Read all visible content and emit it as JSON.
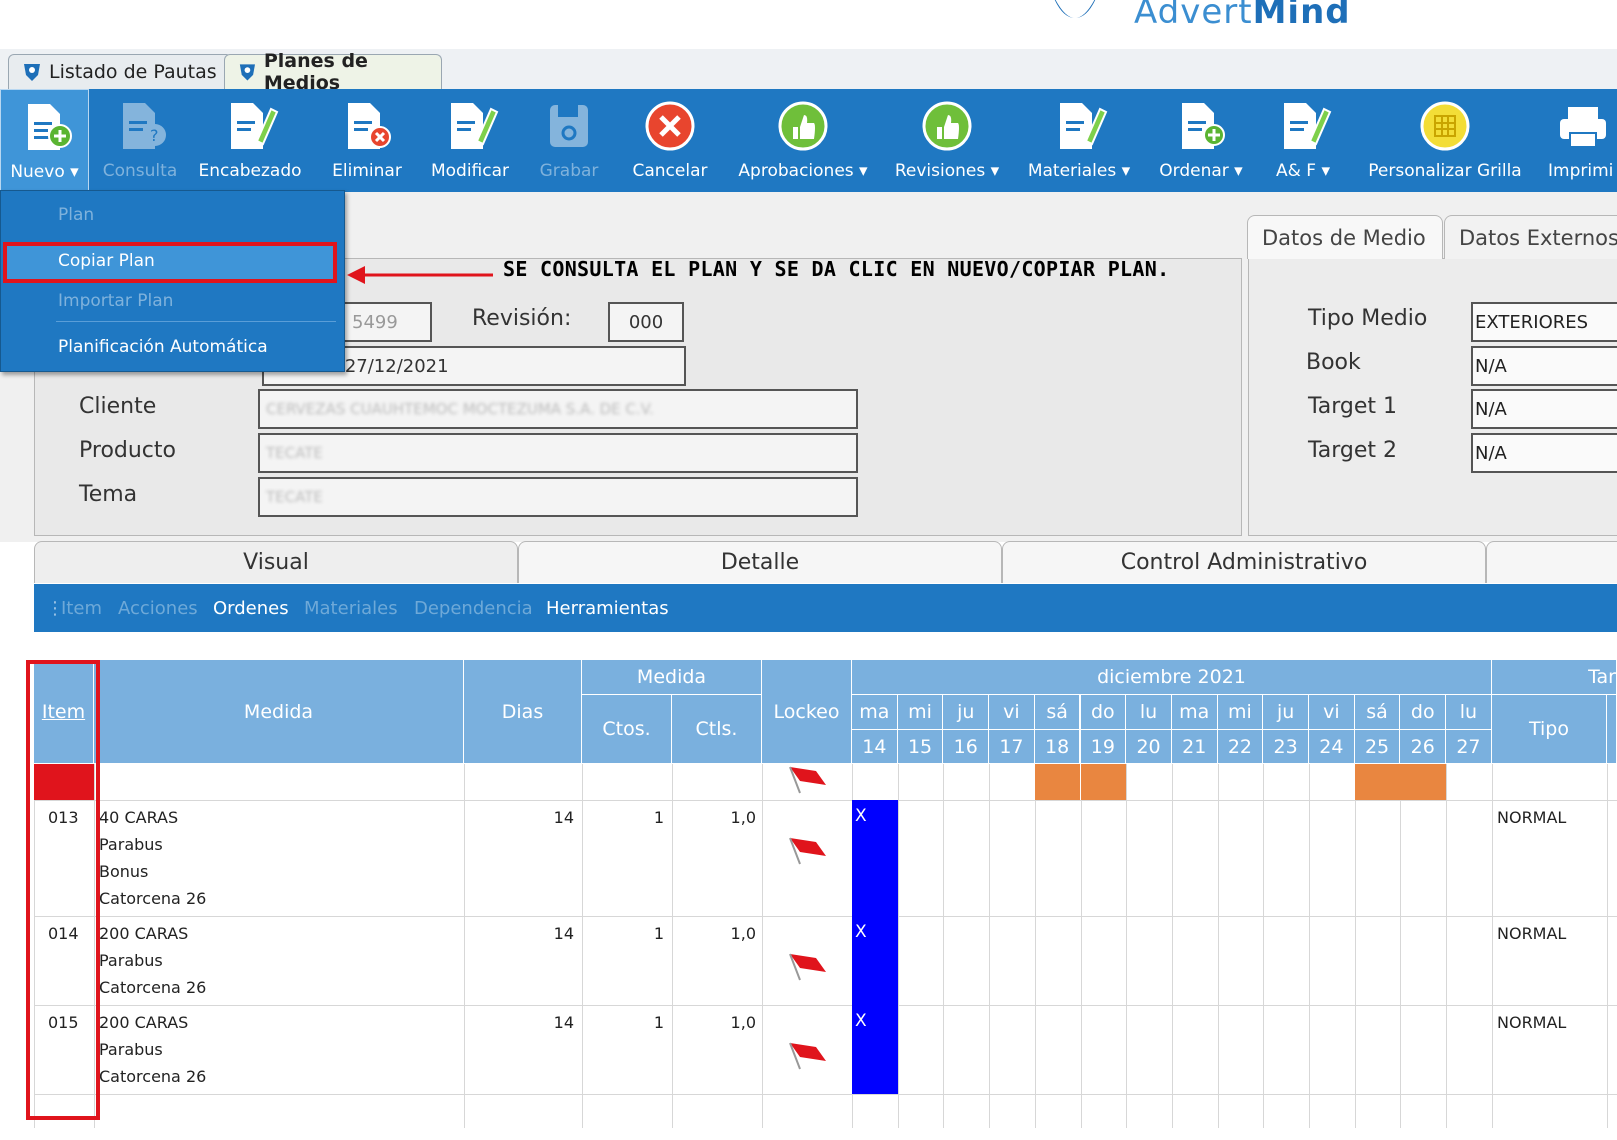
{
  "logo": {
    "text_a": "Advert",
    "text_b": "Mind"
  },
  "doc_tabs": [
    {
      "label": "Listado de Pautas"
    },
    {
      "label": "Planes de Medios"
    }
  ],
  "toolbar": {
    "nuevo": "Nuevo ▾",
    "consulta": "Consulta",
    "encabezado": "Encabezado",
    "eliminar": "Eliminar",
    "modificar": "Modificar",
    "grabar": "Grabar",
    "cancelar": "Cancelar",
    "aprobaciones": "Aprobaciones ▾",
    "revisiones": "Revisiones ▾",
    "materiales": "Materiales ▾",
    "ordenar": "Ordenar ▾",
    "ayf": "A& F ▾",
    "personalizar": "Personalizar Grilla",
    "imprimir": "Imprimi"
  },
  "dropdown": {
    "plan": "Plan",
    "copiar": "Copiar Plan",
    "importar": "Importar Plan",
    "planificacion": "Planificación Automática"
  },
  "annotation": "SE CONSULTA EL PLAN Y SE DA CLIC EN NUEVO/COPIAR PLAN.",
  "form": {
    "plan_number_partial": "5499",
    "revision_label": "Revisión:",
    "revision_value": "000",
    "periodo_value": "14/12/2021 - 27/12/2021",
    "periodo_visible": "21 - 27/12/2021",
    "cliente_label": "Cliente",
    "cliente_value": "CERVEZAS CUAUHTEMOC MOCTEZUMA S.A. DE C.V.",
    "producto_label": "Producto",
    "producto_value": "TECATE",
    "tema_label": "Tema",
    "tema_value": "TECATE"
  },
  "right_panel": {
    "tab_medio": "Datos de Medio",
    "tab_externos": "Datos Externos",
    "tipo_medio_label": "Tipo Medio",
    "tipo_medio_value": "EXTERIORES",
    "book_label": "Book",
    "book_value": "N/A",
    "target1_label": "Target 1",
    "target1_value": "N/A",
    "target2_label": "Target 2",
    "target2_value": "N/A"
  },
  "bottom_tabs": {
    "visual": "Visual",
    "detalle": "Detalle",
    "control": "Control Administrativo"
  },
  "subtoolbar": {
    "item": "Item",
    "acciones": "Acciones",
    "ordenes": "Ordenes",
    "materiales": "Materiales",
    "dependencia": "Dependencia",
    "herramientas": "Herramientas"
  },
  "grid": {
    "headers": {
      "item": "Item",
      "medida": "Medida",
      "dias": "Dias",
      "medida_group": "Medida",
      "ctos": "Ctos.",
      "ctls": "Ctls.",
      "lockeo": "Lockeo",
      "month": "diciembre 2021",
      "tipo": "Tipo",
      "tar": "Tar"
    },
    "days": [
      {
        "dow": "ma",
        "num": "14"
      },
      {
        "dow": "mi",
        "num": "15"
      },
      {
        "dow": "ju",
        "num": "16"
      },
      {
        "dow": "vi",
        "num": "17"
      },
      {
        "dow": "sá",
        "num": "18"
      },
      {
        "dow": "do",
        "num": "19"
      },
      {
        "dow": "lu",
        "num": "20"
      },
      {
        "dow": "ma",
        "num": "21"
      },
      {
        "dow": "mi",
        "num": "22"
      },
      {
        "dow": "ju",
        "num": "23"
      },
      {
        "dow": "vi",
        "num": "24"
      },
      {
        "dow": "sá",
        "num": "25"
      },
      {
        "dow": "do",
        "num": "26"
      },
      {
        "dow": "lu",
        "num": "27"
      }
    ],
    "rows": [
      {
        "item": "013",
        "lines": [
          "40 CARAS",
          "Parabus",
          "Bonus",
          "Catorcena 26"
        ],
        "dias": "14",
        "ctos": "1",
        "ctls": "1,0",
        "mark": "X",
        "tipo": "NORMAL"
      },
      {
        "item": "014",
        "lines": [
          "200 CARAS",
          "Parabus",
          "Catorcena 26"
        ],
        "dias": "14",
        "ctos": "1",
        "ctls": "1,0",
        "mark": "X",
        "tipo": "NORMAL"
      },
      {
        "item": "015",
        "lines": [
          "200 CARAS",
          "Parabus",
          "Catorcena 26"
        ],
        "dias": "14",
        "ctos": "1",
        "ctls": "1,0",
        "mark": "X",
        "tipo": "NORMAL"
      }
    ]
  },
  "colors": {
    "toolbar": "#1f78c2",
    "header": "#7ab0de",
    "weekend": "#e98640",
    "scheduled": "#0000ff",
    "highlight": "#e0141c"
  }
}
